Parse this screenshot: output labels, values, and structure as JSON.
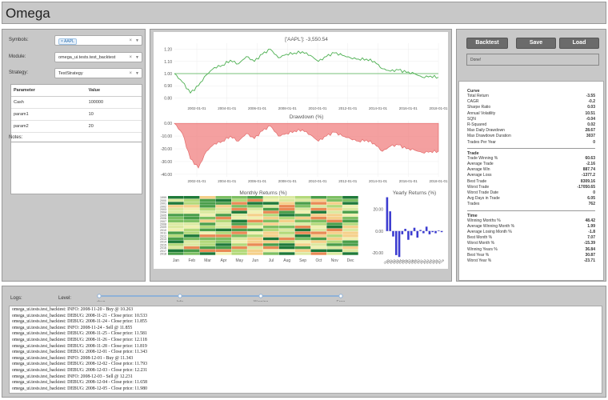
{
  "app": {
    "title": "Omega"
  },
  "form": {
    "symbols_label": "Symbols:",
    "symbols_tag": "AAPL",
    "module_label": "Module:",
    "module_value": "omega_ui.tests.test_backtest",
    "strategy_label": "Strategy:",
    "strategy_value": "TestStrategy",
    "notes_label": "Notes:"
  },
  "params": {
    "headers": [
      "Parameter",
      "Value"
    ],
    "rows": [
      {
        "name": "Cash",
        "value": "100000"
      },
      {
        "name": "param1",
        "value": "10"
      },
      {
        "name": "param2",
        "value": "20"
      }
    ]
  },
  "toolbar": {
    "backtest": "Backtest",
    "save": "Save",
    "load": "Load",
    "status": "Done!"
  },
  "stats": {
    "sections": [
      {
        "title": "Curve",
        "rows": [
          [
            "Total Return",
            "-3.55"
          ],
          [
            "CAGR",
            "-0.2"
          ],
          [
            "Sharpe Ratio",
            "0.03"
          ],
          [
            "Annual Volatility",
            "10.51"
          ],
          [
            "SQN",
            "-0.04"
          ],
          [
            "R-Squared",
            "0.02"
          ],
          [
            "Max Daily Drawdown",
            "28.67"
          ],
          [
            "Max Drawdown Duration",
            "3037"
          ],
          [
            "Trades Per Year",
            "0"
          ]
        ]
      },
      {
        "title": "Trade",
        "rows": [
          [
            "Trade Winning %",
            "60.63"
          ],
          [
            "Average Trade",
            "-2.16"
          ],
          [
            "Average Win",
            "887.74"
          ],
          [
            "Average Loss",
            "-1377.2"
          ],
          [
            "Best Trade",
            "8309.16"
          ],
          [
            "Worst Trade",
            "-17050.65"
          ],
          [
            "Worst Trade Date",
            "0"
          ],
          [
            "Avg Days in Trade",
            "6.05"
          ],
          [
            "Trades",
            "762"
          ]
        ]
      },
      {
        "title": "Time",
        "rows": [
          [
            "Winning Months %",
            "48.42"
          ],
          [
            "Average Winning Month %",
            "1.99"
          ],
          [
            "Average Losing Month %",
            "-1.8"
          ],
          [
            "Best Month %",
            "7.07"
          ],
          [
            "Worst Month %",
            "-15.39"
          ],
          [
            "Winning Years %",
            "36.84"
          ],
          [
            "Best Year %",
            "30.87"
          ],
          [
            "Worst Year %",
            "-23.71"
          ]
        ]
      }
    ]
  },
  "logs": {
    "label": "Logs:",
    "level_label": "Level:",
    "levels": [
      "Debug",
      "Info",
      "Warning",
      "Error"
    ],
    "lines": [
      "omega_ui.tests.test_backtest: INFO: 2008-11-20 - Buy @ 10.263",
      "omega_ui.tests.test_backtest: DEBUG: 2008-11-21 - Close price: 10.533",
      "omega_ui.tests.test_backtest: DEBUG: 2008-11-24 - Close price: 11.855",
      "omega_ui.tests.test_backtest: INFO: 2008-11-24 - Sell @ 11.855",
      "omega_ui.tests.test_backtest: DEBUG: 2008-11-25 - Close price: 11.581",
      "omega_ui.tests.test_backtest: DEBUG: 2008-11-26 - Close price: 12.118",
      "omega_ui.tests.test_backtest: DEBUG: 2008-11-28 - Close price: 11.819",
      "omega_ui.tests.test_backtest: DEBUG: 2008-12-01 - Close price: 11.343",
      "omega_ui.tests.test_backtest: INFO: 2008-12-01 - Buy @ 11.343",
      "omega_ui.tests.test_backtest: DEBUG: 2008-12-02 - Close price: 11.793",
      "omega_ui.tests.test_backtest: DEBUG: 2008-12-03 - Close price: 12.231",
      "omega_ui.tests.test_backtest: INFO: 2008-12-03 - Sell @ 12.231",
      "omega_ui.tests.test_backtest: DEBUG: 2008-12-04 - Close price: 11.658",
      "omega_ui.tests.test_backtest: DEBUG: 2008-12-05 - Close price: 11.980"
    ]
  },
  "chart_data": [
    {
      "type": "line",
      "title": "['AAPL']: -3,550.54",
      "x_ticks": [
        "2002-01-01",
        "2004-01-01",
        "2006-01-01",
        "2008-01-01",
        "2010-01-01",
        "2012-01-01",
        "2014-01-01",
        "2016-01-01",
        "2018-01-01"
      ],
      "y_ticks": [
        "1.20",
        "1.10",
        "1.00",
        "0.90",
        "0.80"
      ],
      "ylim": [
        0.75,
        1.25
      ],
      "baseline": 1.0,
      "color": "#4caf50",
      "series": [
        {
          "values": [
            1.0,
            0.93,
            0.84,
            0.9,
            0.99,
            1.05,
            1.07,
            1.11,
            1.08,
            1.14,
            1.1,
            1.16,
            1.2,
            1.13,
            1.16,
            1.17,
            1.18,
            1.15,
            1.1,
            1.14,
            1.17,
            1.15,
            1.13,
            1.12,
            1.12,
            1.1,
            1.04,
            1.02,
            1.03,
            1.01,
            1.0,
            0.97,
            0.98,
            0.97
          ]
        }
      ]
    },
    {
      "type": "area",
      "title": "Drawdown (%)",
      "x_ticks": [
        "2002-01-01",
        "2004-01-01",
        "2006-01-01",
        "2008-01-01",
        "2010-01-01",
        "2012-01-01",
        "2014-01-01",
        "2016-01-01",
        "2018-01-01"
      ],
      "y_ticks": [
        "0.00",
        "-10.00",
        "-20.00",
        "-30.00",
        "-40.00"
      ],
      "ylim": [
        -42,
        2
      ],
      "color": "#f08080",
      "series": [
        {
          "values": [
            0,
            -8,
            -28,
            -35,
            -22,
            -16,
            -14,
            -10,
            -14,
            -8,
            -12,
            -6,
            -2,
            -10,
            -8,
            -6,
            -5,
            -9,
            -14,
            -10,
            -7,
            -10,
            -12,
            -14,
            -13,
            -16,
            -22,
            -18,
            -17,
            -20,
            -21,
            -23,
            -22,
            -22
          ]
        }
      ]
    },
    {
      "type": "heatmap",
      "title": "Monthly Returns (%)",
      "months": [
        "Jan",
        "Feb",
        "Mar",
        "Apr",
        "May",
        "Jun",
        "Jul",
        "Aug",
        "Sep",
        "Oct",
        "Nov",
        "Dec"
      ],
      "years": [
        "1999",
        "2000",
        "2001",
        "2002",
        "2003",
        "2004",
        "2005",
        "2006",
        "2007",
        "2008",
        "2009",
        "2010",
        "2011",
        "2012",
        "2013",
        "2014",
        "2015",
        "2016",
        "2017",
        "2018"
      ]
    },
    {
      "type": "bar",
      "title": "Yearly Returns (%)",
      "y_ticks": [
        "20.00",
        "0.00",
        "-20.00"
      ],
      "ylim": [
        -25,
        32
      ],
      "values": [
        30.87,
        18,
        -5,
        -22,
        -23.71,
        -3,
        2,
        -8,
        -4,
        3,
        -6,
        1,
        -2,
        4,
        -3,
        -1,
        -2,
        0.5,
        -1
      ]
    }
  ]
}
